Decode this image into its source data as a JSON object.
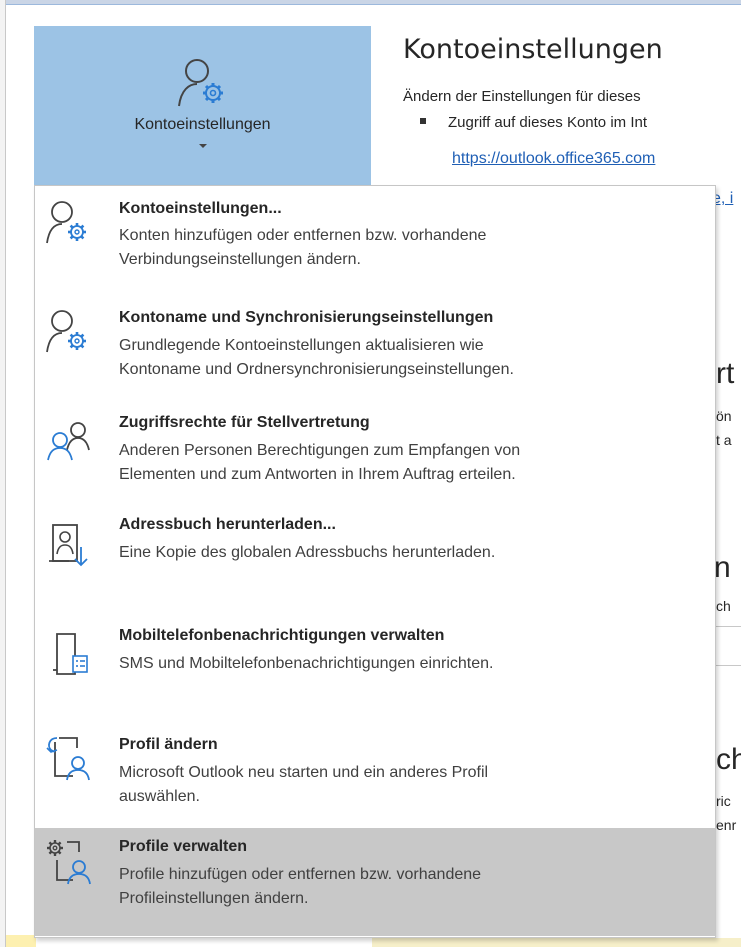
{
  "ribbon_button": {
    "label": "Kontoeinstellungen",
    "icon": "person-gear-icon"
  },
  "background": {
    "title": "Kontoeinstellungen",
    "description": "Ändern der Einstellungen für dieses",
    "bullet": "Zugriff auf dieses Konto im Int",
    "link": "https://outlook.office365.com",
    "link_fragment": "e, i",
    "fragments": [
      "rt",
      "ön",
      "t a",
      "n",
      "ch",
      "ch",
      "ric",
      "enr"
    ]
  },
  "menu": {
    "items": [
      {
        "title": "Kontoeinstellungen...",
        "desc": [
          "Konten hinzufügen oder entfernen bzw. vorhandene",
          "Verbindungseinstellungen ändern."
        ],
        "icon": "person-gear-icon"
      },
      {
        "title": "Kontoname und Synchronisierungseinstellungen",
        "desc": [
          "Grundlegende Kontoeinstellungen aktualisieren wie",
          "Kontoname und Ordnersynchronisierungseinstellungen."
        ],
        "icon": "person-gear-icon"
      },
      {
        "title": "Zugriffsrechte für Stellvertretung",
        "desc": [
          "Anderen Personen Berechtigungen zum Empfangen von",
          "Elementen und zum Antworten in Ihrem Auftrag erteilen."
        ],
        "icon": "two-people-icon"
      },
      {
        "title": "Adressbuch herunterladen...",
        "desc": [
          "Eine Kopie des globalen Adressbuchs herunterladen."
        ],
        "icon": "address-book-download-icon"
      },
      {
        "title": "Mobiltelefonbenachrichtigungen verwalten",
        "desc": [
          "SMS und Mobiltelefonbenachrichtigungen einrichten."
        ],
        "icon": "mobile-notifications-icon"
      },
      {
        "title": "Profil ändern",
        "desc": [
          "Microsoft Outlook neu starten und ein anderes Profil",
          "auswählen."
        ],
        "icon": "change-profile-icon"
      },
      {
        "title": "Profile verwalten",
        "desc": [
          "Profile hinzufügen oder entfernen bzw. vorhandene",
          "Profileinstellungen ändern."
        ],
        "icon": "manage-profiles-icon",
        "selected": true
      }
    ]
  },
  "colors": {
    "ribbon_button_bg": "#9cc3e5",
    "accent_blue": "#2b7cd3",
    "link": "#1f5fb5",
    "selected_bg": "#c8c8c8"
  }
}
